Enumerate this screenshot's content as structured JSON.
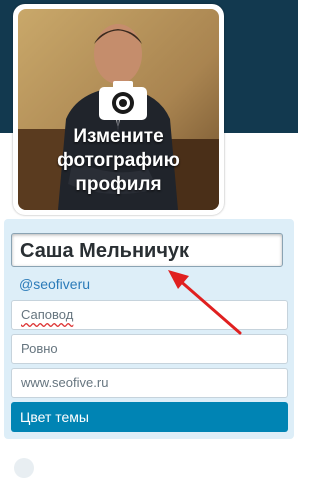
{
  "profile": {
    "change_photo_text": "Измените\nфотографию\nпрофиля",
    "name_value": "Саша Мельничук",
    "handle": "@seofiveru",
    "bio_value": "Саповод",
    "location_value": "Ровно",
    "website_value": "www.seofive.ru",
    "theme_color_label": "Цвет темы"
  },
  "colors": {
    "header": "#12394f",
    "panel": "#ddeef8",
    "theme_button": "#0084b4",
    "annotation_arrow": "#e02020"
  },
  "icons": {
    "camera": "camera-icon",
    "arrow": "annotation-arrow"
  }
}
